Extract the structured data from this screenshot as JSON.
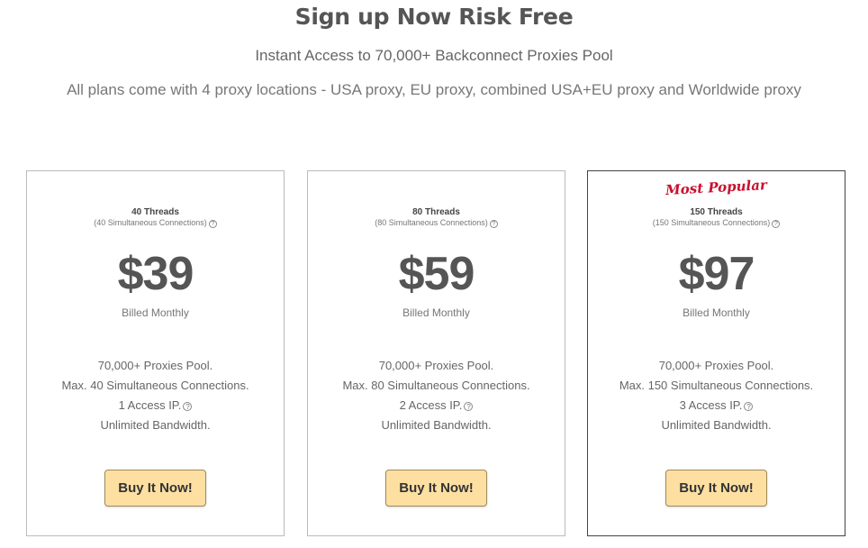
{
  "header": {
    "title": "Sign up Now Risk Free",
    "subtitle": "Instant Access to 70,000+ Backconnect Proxies Pool",
    "subtitle2": "All plans come with 4 proxy locations - USA proxy, EU proxy, combined USA+EU proxy and Worldwide proxy"
  },
  "plans": [
    {
      "ribbon": "",
      "threads": "40 Threads",
      "connections": "(40 Simultaneous Connections)",
      "price": "$39",
      "billing": "Billed Monthly",
      "features": [
        "70,000+ Proxies Pool.",
        "Max. 40 Simultaneous Connections.",
        "1 Access IP.",
        "Unlimited Bandwidth."
      ],
      "button": "Buy It Now!"
    },
    {
      "ribbon": "",
      "threads": "80 Threads",
      "connections": "(80 Simultaneous Connections)",
      "price": "$59",
      "billing": "Billed Monthly",
      "features": [
        "70,000+ Proxies Pool.",
        "Max. 80 Simultaneous Connections.",
        "2 Access IP.",
        "Unlimited Bandwidth."
      ],
      "button": "Buy It Now!"
    },
    {
      "ribbon": "Most Popular",
      "threads": "150 Threads",
      "connections": "(150 Simultaneous Connections)",
      "price": "$97",
      "billing": "Billed Monthly",
      "features": [
        "70,000+ Proxies Pool.",
        "Max. 150 Simultaneous Connections.",
        "3 Access IP.",
        "Unlimited Bandwidth."
      ],
      "button": "Buy It Now!"
    }
  ],
  "help_glyph": "?",
  "colors": {
    "button_bg": "#fddfa2",
    "ribbon": "#c8102e",
    "text": "#555555"
  }
}
